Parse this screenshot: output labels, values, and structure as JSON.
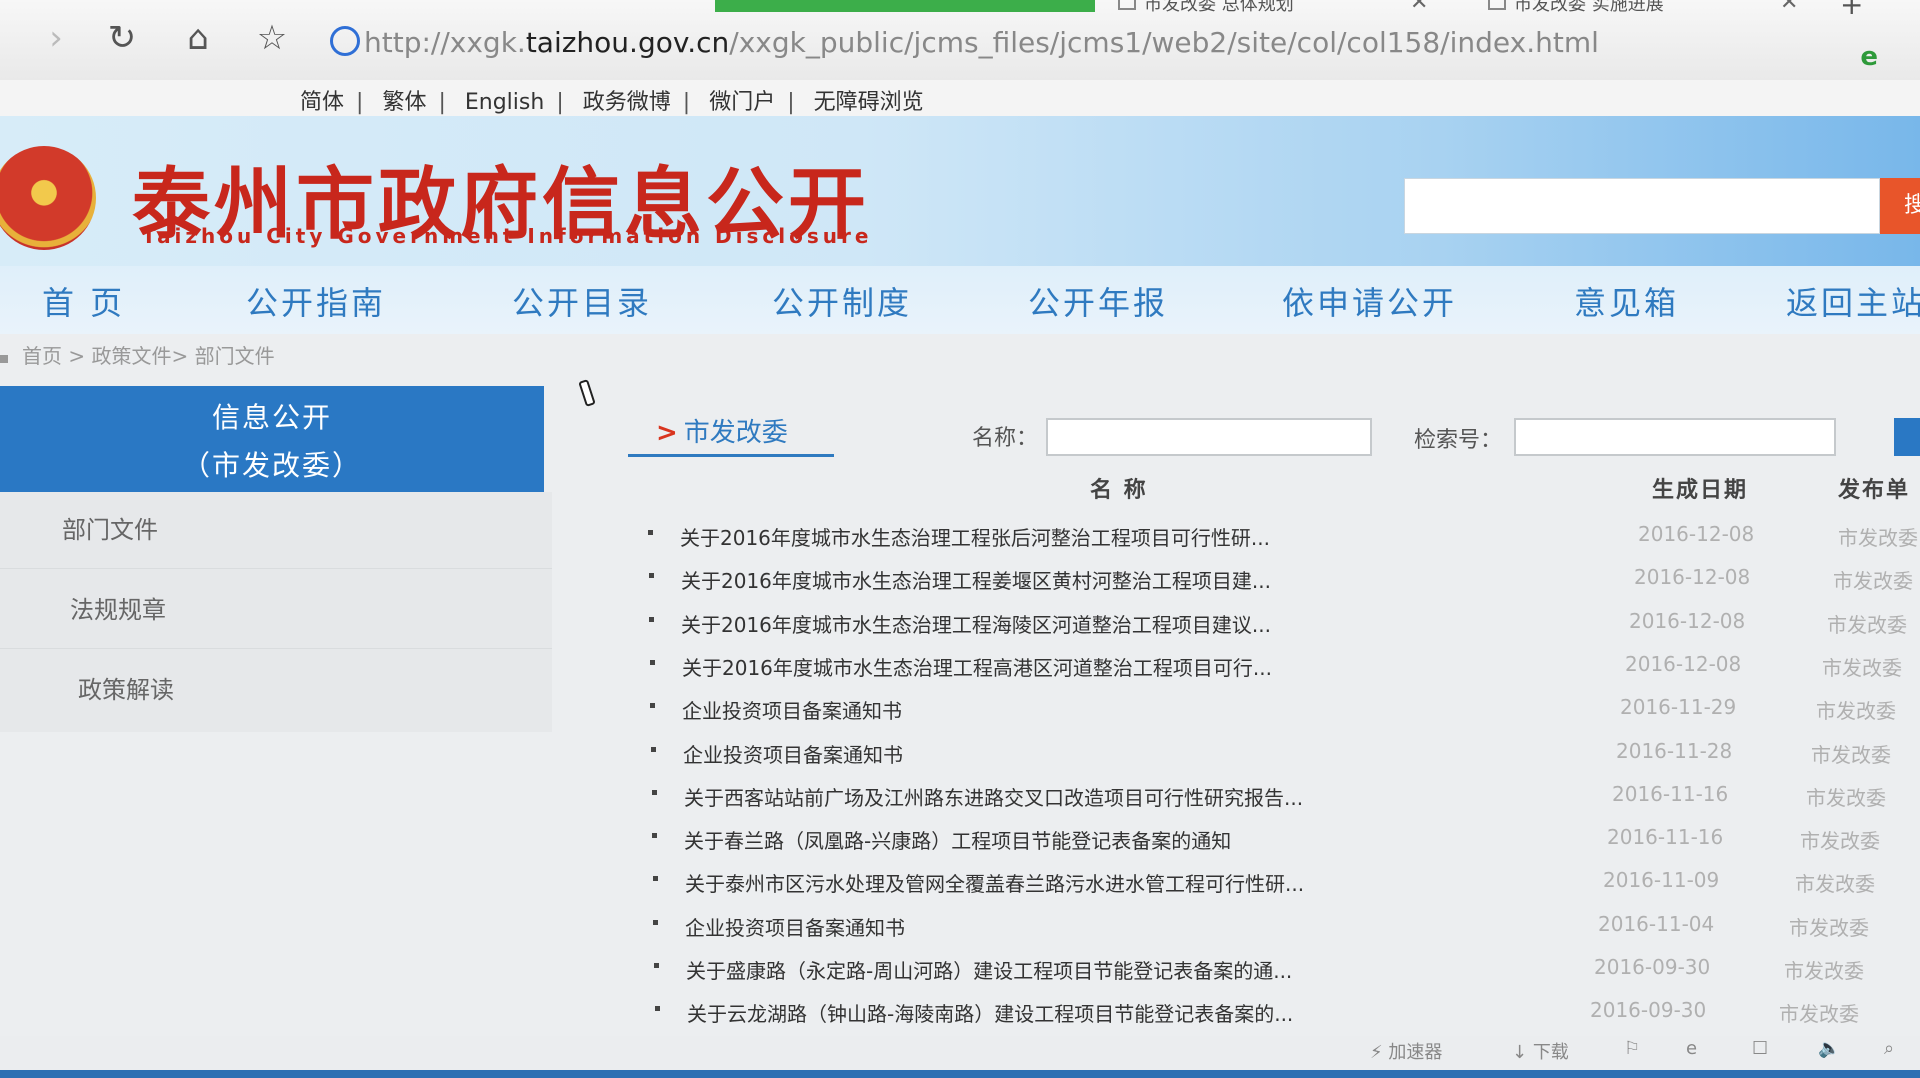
{
  "browser": {
    "tabs": [
      {
        "label": "市发改委 总体规划"
      },
      {
        "label": "市发改委 实施进展"
      }
    ],
    "new_tab": "+",
    "url_prefix": "http://xxgk.",
    "url_host": "taizhou.gov.cn",
    "url_path": "/xxgk_public/jcms_files/jcms1/web2/site/col/col158/index.html",
    "icons": [
      "forward-icon",
      "refresh-icon",
      "home-icon",
      "star-icon"
    ]
  },
  "toplinks": [
    "简体",
    "繁体",
    "English",
    "政务微博",
    "微门户",
    "无障碍浏览"
  ],
  "banner": {
    "title": "泰州市政府信息公开",
    "subtitle": "Taizhou City Government Information Disclosure",
    "search_button": "搜"
  },
  "nav": [
    "首 页",
    "公开指南",
    "公开目录",
    "公开制度",
    "公开年报",
    "依申请公开",
    "意见箱",
    "返回主站"
  ],
  "breadcrumb": [
    "首页",
    "政策文件",
    "部门文件"
  ],
  "sidebar": {
    "title_line1": "信息公开",
    "title_line2": "（市发改委）",
    "items": [
      "部门文件",
      "法规规章",
      "政策解读"
    ]
  },
  "content": {
    "tab": "市发改委",
    "name_label": "名称：",
    "index_label": "检索号：",
    "columns": [
      "名 称",
      "生成日期",
      "发布单"
    ],
    "rows": [
      {
        "title": "关于2016年度城市水生态治理工程张后河整治工程项目可行性研...",
        "date": "2016-12-08",
        "dept": "市发改委"
      },
      {
        "title": "关于2016年度城市水生态治理工程姜堰区黄村河整治工程项目建...",
        "date": "2016-12-08",
        "dept": "市发改委"
      },
      {
        "title": "关于2016年度城市水生态治理工程海陵区河道整治工程项目建议...",
        "date": "2016-12-08",
        "dept": "市发改委"
      },
      {
        "title": "关于2016年度城市水生态治理工程高港区河道整治工程项目可行...",
        "date": "2016-12-08",
        "dept": "市发改委"
      },
      {
        "title": "企业投资项目备案通知书",
        "date": "2016-11-29",
        "dept": "市发改委"
      },
      {
        "title": "企业投资项目备案通知书",
        "date": "2016-11-28",
        "dept": "市发改委"
      },
      {
        "title": "关于西客站站前广场及江州路东进路交叉口改造项目可行性研究报告...",
        "date": "2016-11-16",
        "dept": "市发改委"
      },
      {
        "title": "关于春兰路（凤凰路-兴康路）工程项目节能登记表备案的通知",
        "date": "2016-11-16",
        "dept": "市发改委"
      },
      {
        "title": "关于泰州市区污水处理及管网全覆盖春兰路污水进水管工程可行性研...",
        "date": "2016-11-09",
        "dept": "市发改委"
      },
      {
        "title": "企业投资项目备案通知书",
        "date": "2016-11-04",
        "dept": "市发改委"
      },
      {
        "title": "关于盛康路（永定路-周山河路）建设工程项目节能登记表备案的通...",
        "date": "2016-09-30",
        "dept": "市发改委"
      },
      {
        "title": "关于云龙湖路（钟山路-海陵南路）建设工程项目节能登记表备案的...",
        "date": "2016-09-30",
        "dept": "市发改委"
      }
    ]
  },
  "statusbar": [
    "加速器",
    "下载"
  ],
  "colors": {
    "accent": "#2a78c4",
    "title_red": "#c8271c",
    "nav_blue": "#2f7ac0"
  }
}
